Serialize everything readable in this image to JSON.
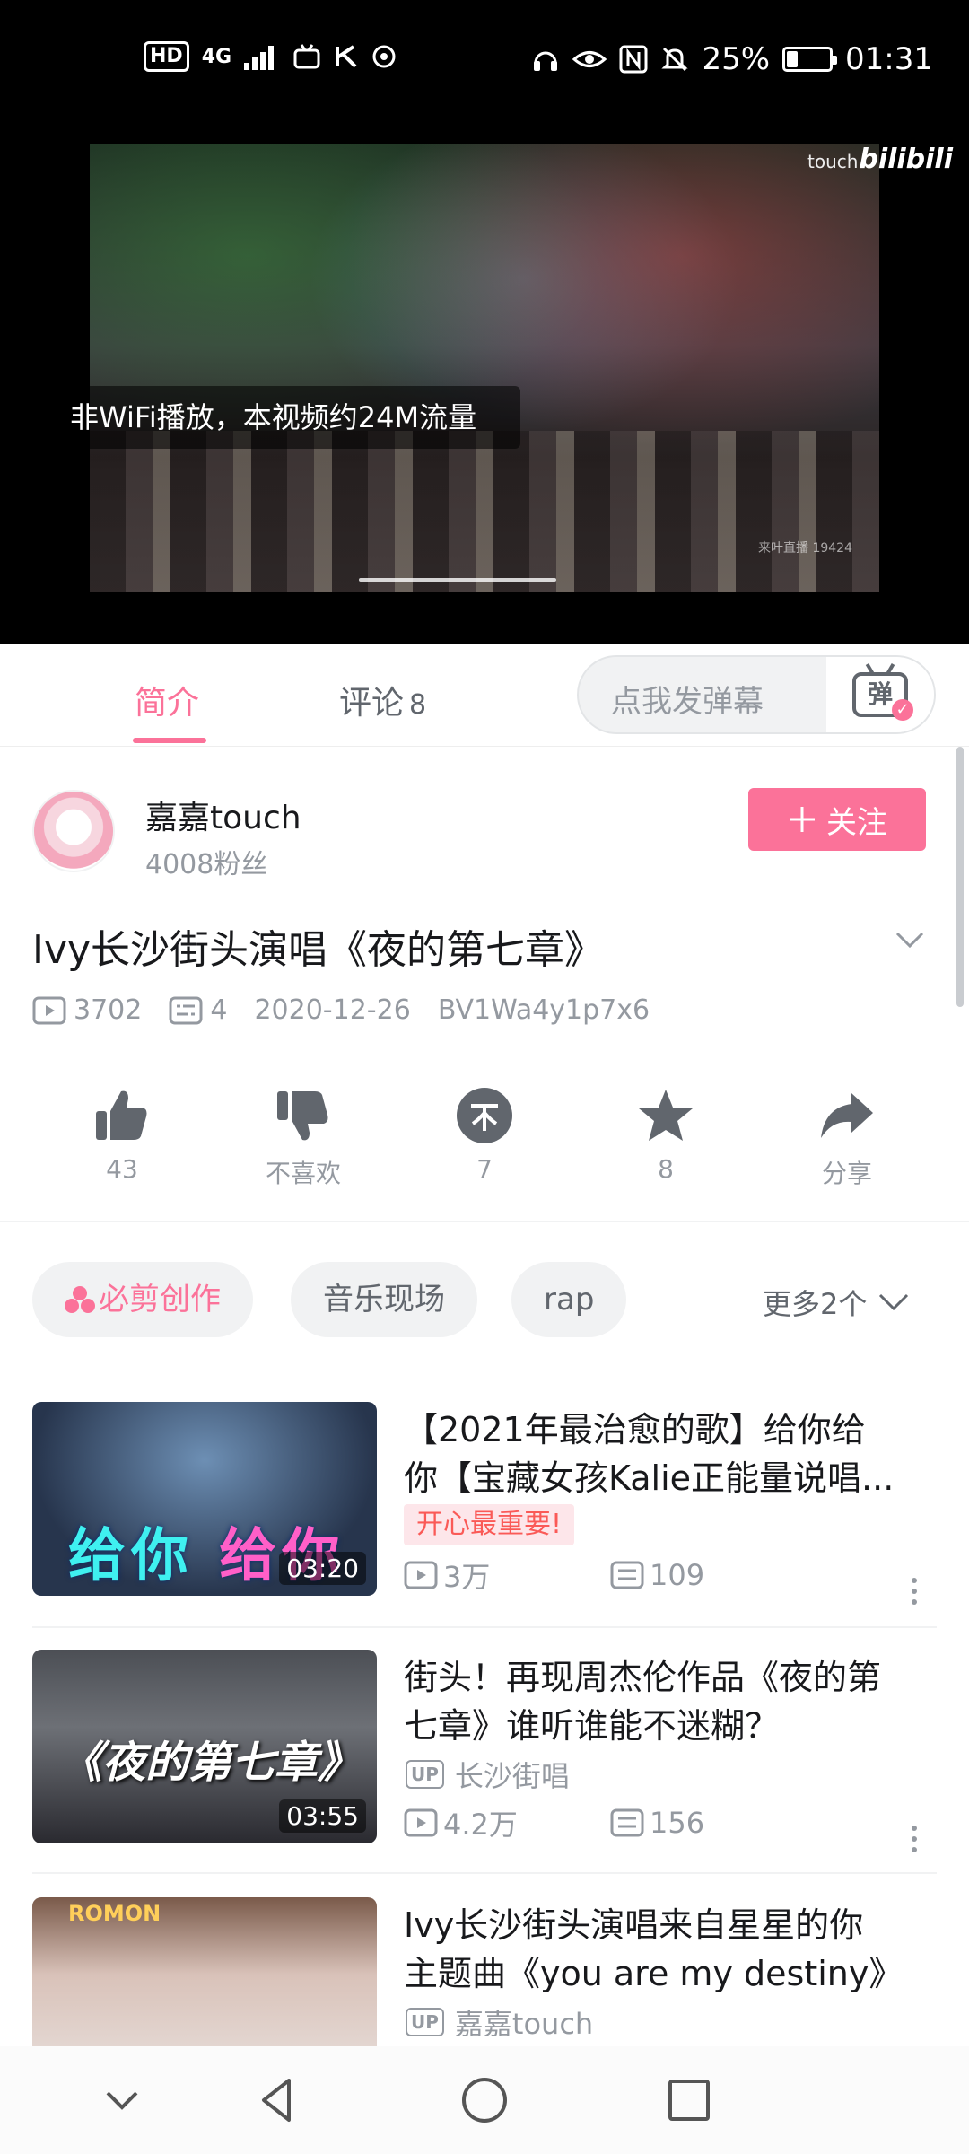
{
  "status_bar": {
    "hd": "HD",
    "network": "4G",
    "battery_text": "25%",
    "battery_level": 0.25,
    "time": "01:31"
  },
  "player": {
    "brand": "bilibili",
    "uploader_watermark": "touch",
    "small_watermark": "来叶直播 19424",
    "toast": "非WiFi播放，本视频约24M流量"
  },
  "tabs": {
    "intro": "简介",
    "comments": "评论",
    "comments_count": "8",
    "danmaku_placeholder": "点我发弹幕",
    "danmaku_icon_glyph": "弹"
  },
  "uploader": {
    "name": "嘉嘉touch",
    "fans": "4008粉丝",
    "follow": "关注"
  },
  "video": {
    "title": "Ivy长沙街头演唱《夜的第七章》",
    "views": "3702",
    "danmaku": "4",
    "date": "2020-12-26",
    "bvid": "BV1Wa4y1p7x6"
  },
  "actions": {
    "like": "43",
    "dislike": "不喜欢",
    "coin": "7",
    "favorite": "8",
    "share": "分享"
  },
  "tags": {
    "items": [
      "必剪创作",
      "音乐现场",
      "rap"
    ],
    "more": "更多2个"
  },
  "related": [
    {
      "title_line1": "【2021年最治愈的歌】给你给",
      "title_line2": "你【宝藏女孩Kalie正能量说唱...",
      "badge": "开心最重要!",
      "views": "3万",
      "comments": "109",
      "duration": "03:20",
      "thumb_text_a": "给你",
      "thumb_text_b": "给你"
    },
    {
      "title_line1": "街头！再现周杰伦作品《夜的第",
      "title_line2": "七章》谁听谁能不迷糊？",
      "uploader": "长沙街唱",
      "views": "4.2万",
      "comments": "156",
      "duration": "03:55",
      "thumb_text": "《夜的第七章》"
    },
    {
      "title_line1": "Ivy长沙街头演唱来自星星的你",
      "title_line2": "主题曲《you are my destiny》",
      "uploader": "嘉嘉touch",
      "thumb_sign": "ROMON"
    }
  ],
  "up_mark": "UP",
  "colors": {
    "accent": "#fb7299",
    "text_secondary": "#9499a0"
  }
}
